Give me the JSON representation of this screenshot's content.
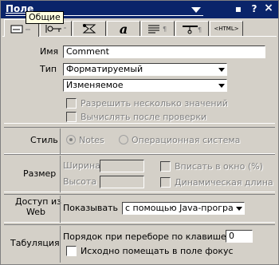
{
  "window": {
    "title": "Поле",
    "tooltip": "Общие",
    "controls": {
      "restore": "▪",
      "help": "?",
      "close": "×"
    }
  },
  "tabs": [
    {
      "name": "tab-general",
      "label": "",
      "active": true
    },
    {
      "name": "tab-keys",
      "label": ""
    },
    {
      "name": "tab-advanced",
      "label": ""
    },
    {
      "name": "tab-font",
      "label": "a"
    },
    {
      "name": "tab-paragraph",
      "label": "≡"
    },
    {
      "name": "tab-hide",
      "label": ""
    },
    {
      "name": "tab-html",
      "label": "<HTML>"
    }
  ],
  "basics": {
    "name_label": "Имя",
    "name_value": "Comment",
    "type_label": "Тип",
    "type_value": "Форматируемый",
    "mode_value": "Изменяемое",
    "allow_multiple": "Разрешить несколько значений",
    "compute_after": "Вычислять после проверки"
  },
  "style": {
    "label": "Стиль",
    "notes": "Notes",
    "os": "Операционная система"
  },
  "size": {
    "label": "Размер",
    "width": "Ширина",
    "height": "Высота",
    "fit_window": "Вписать в окно (%)",
    "dynamic_length": "Динамическая длина"
  },
  "web": {
    "label_line1": "Доступ из",
    "label_line2": "Web",
    "show_label": "Показывать",
    "show_value": "с помощью Java-програм"
  },
  "tabbing": {
    "label": "Табуляция",
    "order_label": "Порядок при переборе по клавише Tab",
    "order_value": "0",
    "initial_focus": "Исходно помещать в поле фокус"
  }
}
